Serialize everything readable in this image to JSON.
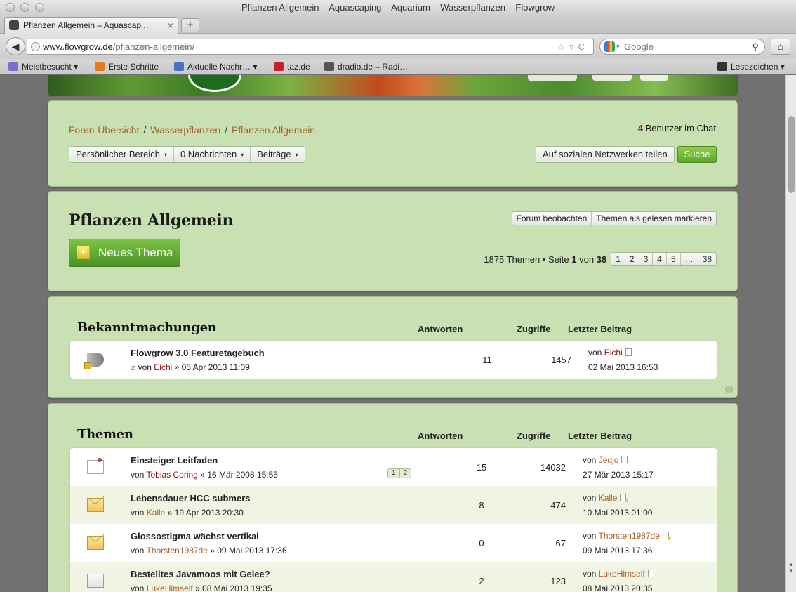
{
  "window": {
    "title": "Pflanzen Allgemein – Aquascaping – Aquarium – Wasserpflanzen – Flowgrow"
  },
  "tab": {
    "title": "Pflanzen Allgemein – Aquascapi…",
    "close": "×",
    "new_tab": "+"
  },
  "nav": {
    "back": "◀",
    "url_host": "www.flowgrow.de",
    "url_path": "/pflanzen-allgemein/",
    "url_icons": "☆▿C",
    "search_placeholder": "Google",
    "search_caret": "▾",
    "search_glass": "⚲",
    "home": "⌂"
  },
  "bookmarks": {
    "items": [
      {
        "label": "Meistbesucht ▾",
        "color": "#7a6fd0"
      },
      {
        "label": "Erste Schritte",
        "color": "#e57a1e"
      },
      {
        "label": "Aktuelle Nachr… ▾",
        "color": "#4a72c9"
      },
      {
        "label": "taz.de",
        "color": "#c8202b"
      },
      {
        "label": "dradio.de – Radi…",
        "color": "#555555"
      }
    ],
    "right_label": "Lesezeichen ▾"
  },
  "breadcrumb": {
    "items": [
      "Foren-Übersicht",
      "Wasserpflanzen",
      "Pflanzen Allgemein"
    ],
    "separator": "/"
  },
  "chat": {
    "count": "4",
    "label": "Benutzer im Chat"
  },
  "menu": {
    "personal": "Persönlicher Bereich",
    "messages": "0 Nachrichten",
    "posts": "Beiträge",
    "arrow": "▾"
  },
  "share_label": "Auf sozialen Netzwerken teilen",
  "search_label": "Suche",
  "forum": {
    "title": "Pflanzen Allgemein",
    "new_thread": "Neues Thema",
    "new_thread_icon": "+",
    "watch": "Forum beobachten",
    "mark_read": "Themen als gelesen markieren",
    "summary_prefix": "1875 Themen • Seite",
    "current_page": "1",
    "summary_of": "von",
    "total_pages": "38",
    "pages": [
      "1",
      "2",
      "3",
      "4",
      "5",
      "…",
      "38"
    ]
  },
  "columns": {
    "answers": "Antworten",
    "views": "Zugriffe",
    "last_post": "Letzter Beitrag"
  },
  "announcements": {
    "title": "Bekanntmachungen",
    "rows": [
      {
        "title": "Flowgrow 3.0 Featuretagebuch",
        "attachment": "⌀",
        "by": "von",
        "author": "Eichi",
        "date": "» 05 Apr 2013 11:09",
        "answers": "11",
        "views": "1457",
        "last_by": "von",
        "last_user": "Eichi",
        "last_date": "02 Mai 2013 16:53",
        "icon": "megaphone-icon"
      }
    ]
  },
  "topics": {
    "title": "Themen",
    "rows": [
      {
        "title": "Einsteiger Leitfaden",
        "by": "von",
        "author": "Tobias Coring",
        "date": "» 16 Mär 2008 15:55",
        "pages": [
          "1",
          "2"
        ],
        "answers": "15",
        "views": "14032",
        "last_by": "von",
        "last_user": "Jedjo",
        "last_date": "27 Mär 2013 15:17",
        "icon": "sticky-note-icon"
      },
      {
        "title": "Lebensdauer HCC submers",
        "by": "von",
        "author": "Kalle",
        "date": "» 19 Apr 2013 20:30",
        "answers": "8",
        "views": "474",
        "last_by": "von",
        "last_user": "Kalle",
        "last_date": "10 Mai 2013 01:00",
        "icon": "envelope-unread-icon"
      },
      {
        "title": "Glossostigma wächst vertikal",
        "by": "von",
        "author": "Thorsten1987de",
        "date": "» 09 Mai 2013 17:36",
        "answers": "0",
        "views": "67",
        "last_by": "von",
        "last_user": "Thorsten1987de",
        "last_date": "09 Mai 2013 17:36",
        "icon": "envelope-unread-icon"
      },
      {
        "title": "Bestelltes Javamoos mit Gelee?",
        "by": "von",
        "author": "LukeHimself",
        "date": "» 08 Mai 2013 19:35",
        "answers": "2",
        "views": "123",
        "last_by": "von",
        "last_user": "LukeHimself",
        "last_date": "08 Mai 2013 20:35",
        "icon": "envelope-read-icon"
      }
    ]
  }
}
